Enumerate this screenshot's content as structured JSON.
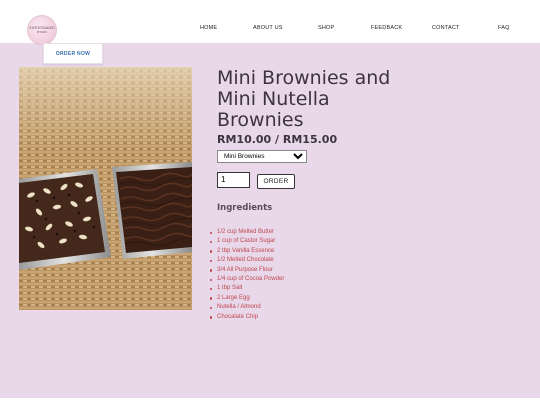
{
  "brand": {
    "logo_lines": [
      "SWEETBAKED",
      "treats"
    ]
  },
  "nav": {
    "items": [
      {
        "label": "HOME"
      },
      {
        "label": "ABOUT US"
      },
      {
        "label": "SHOP"
      },
      {
        "label": "FEEDBACK"
      },
      {
        "label": "CONTACT"
      },
      {
        "label": "FAQ"
      }
    ]
  },
  "cta": {
    "order_now_label": "ORDER NOW",
    "color": "#3a6fb0"
  },
  "product": {
    "title": "Mini Brownies and Mini Nutella Brownies",
    "price": "RM10.00 / RM15.00",
    "variant_selected": "Mini Brownies",
    "quantity": "1",
    "order_label": "ORDER"
  },
  "ingredients": {
    "heading": "Ingredients",
    "items": [
      "1/2 cup Melted Butter",
      "1 cup of Castor Sugar",
      "2 tbp Vanilla Essence",
      "1/2 Melted Chocolate",
      "3/4 All Purpose Flour",
      "1/4 cup of Cocoa Powder",
      "1 tbp Salt",
      "2 Large Egg",
      "Nutella / Almond",
      "Chocalate Chip"
    ],
    "color": "#c0474d"
  },
  "colors": {
    "background": "#e8d8ea",
    "header": "#ffffff",
    "title": "#3e3340"
  }
}
